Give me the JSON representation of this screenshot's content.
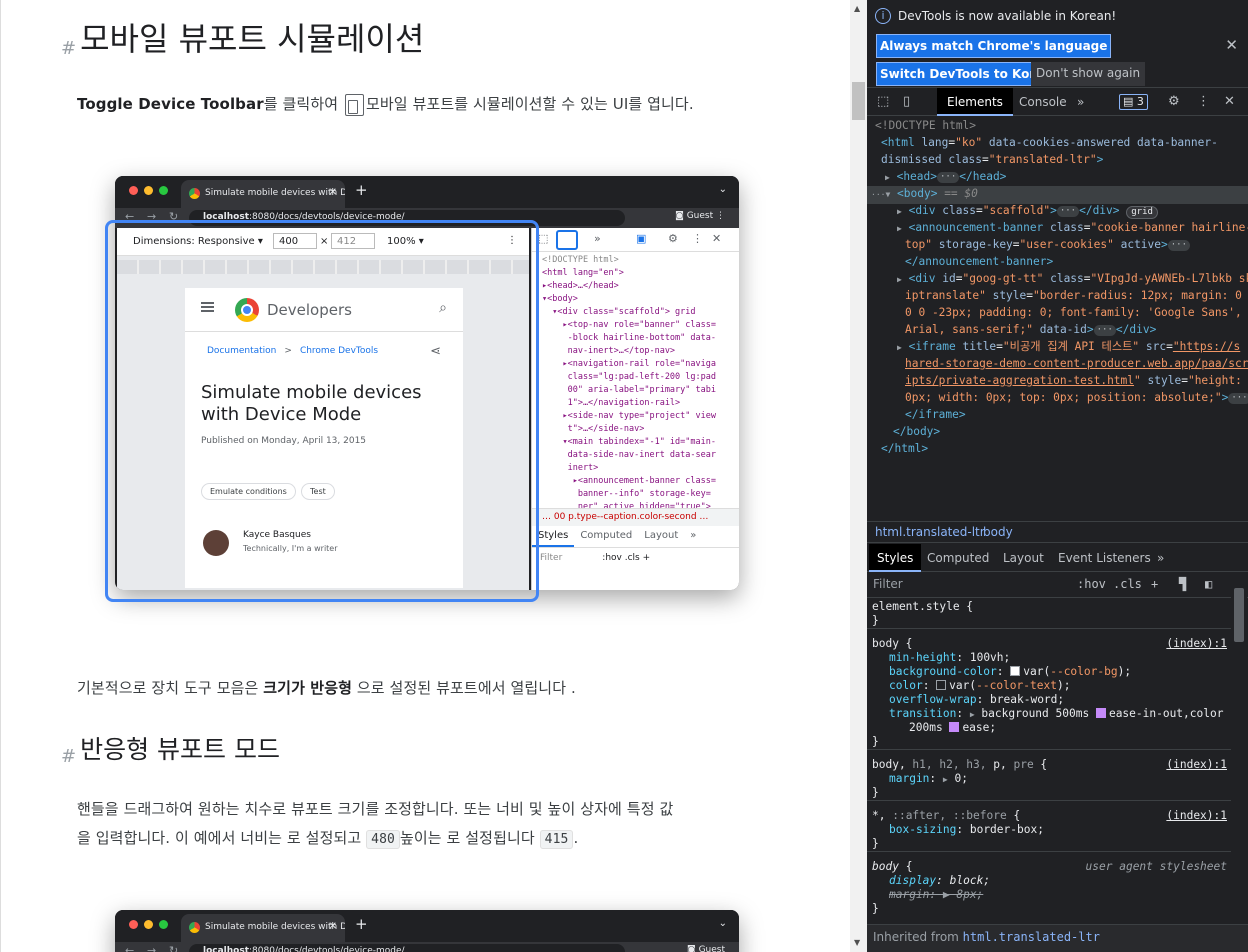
{
  "page": {
    "h1": "모바일 뷰포트 시뮬레이션",
    "h1_anchor": "#",
    "p1_bold": "Toggle Device Toolbar",
    "p1_mid": "를 클릭하여 ",
    "p1_end": "모바일 뷰포트를 시뮬레이션할 수 있는 UI를 엽니다.",
    "p2_start": "기본적으로 장치 도구 모음은 ",
    "p2_bold": "크기가 반응형",
    "p2_end": " 으로 설정된 뷰포트에서 열립니다 .",
    "h2": "반응형 뷰포트 모드",
    "h2_anchor": "#",
    "p3_line1": "핸들을 드래그하여 원하는 치수로 뷰포트 크기를 조정합니다. 또는 너비 및 높이 상자에 특정 값",
    "p3_line2_a": "을 입력합니다. 이 예에서 너비는 로 설정되고 ",
    "p3_code1": "480",
    "p3_line2_b": "높이는 로 설정됩니다 ",
    "p3_code2": "415",
    "p3_line2_c": "."
  },
  "figure": {
    "tab_title": "Simulate mobile devices with D",
    "tab_close": "✕",
    "new_tab": "+",
    "url_host": "localhost",
    "url_rest": ":8080/docs/devtools/device-mode/",
    "guest": "Guest",
    "dimensions_label": "Dimensions: Responsive ▾",
    "width": "400",
    "times": "×",
    "height": "412",
    "zoom": "100% ▾",
    "brand": "Developers",
    "crumb1": "Documentation",
    "crumb_sep": ">",
    "crumb2": "Chrome DevTools",
    "title": "Simulate mobile devices with Device Mode",
    "published": "Published on Monday, April 13, 2015",
    "chip1": "Emulate conditions",
    "chip2": "Test",
    "author": "Kayce Basques",
    "author_sub": "Technically, I'm a writer",
    "dt_lines": [
      "<!DOCTYPE html>",
      "<html lang=\"en\">",
      "▸<head>…</head>",
      "▾<body>",
      "  ▾<div class=\"scaffold\"> grid",
      "    ▸<top-nav role=\"banner\" class=",
      "     -block hairline-bottom\" data-",
      "     nav-inert>…</top-nav>",
      "    ▸<navigation-rail role=\"naviga",
      "     class=\"lg:pad-left-200 lg:pad",
      "     00\" aria-label=\"primary\" tabi",
      "     1\">…</navigation-rail>",
      "    ▸<side-nav type=\"project\" view",
      "     t\">…</side-nav>",
      "    ▾<main tabindex=\"-1\" id=\"main-",
      "     data-side-nav-inert data-sear",
      "     inert>",
      "      ▸<announcement-banner class=",
      "       banner--info\" storage-key=",
      "       ner\" active hidden=\"true\">"
    ],
    "dt_crumb": "…  00   p.type--caption.color-second  …",
    "dt_tabs": [
      "Styles",
      "Computed",
      "Layout",
      "»"
    ],
    "dt_filter": "Filter",
    "dt_hov": ":hov  .cls  +"
  },
  "devtools": {
    "notice": "DevTools is now available in Korean!",
    "btn_match": "Always match Chrome's language",
    "btn_switch": "Switch DevTools to Korean",
    "btn_dont": "Don't show again",
    "tabs": [
      "Elements",
      "Console",
      "»"
    ],
    "issues_count": "3",
    "crumb1": "html.translated-ltr",
    "crumb2": "body",
    "style_tabs": [
      "Styles",
      "Computed",
      "Layout",
      "Event Listeners",
      "»"
    ],
    "filter_placeholder": "Filter",
    "hov": ":hov",
    "cls": ".cls",
    "inherited_label": "Inherited from ",
    "inherited_from": "html.translated-ltr"
  }
}
